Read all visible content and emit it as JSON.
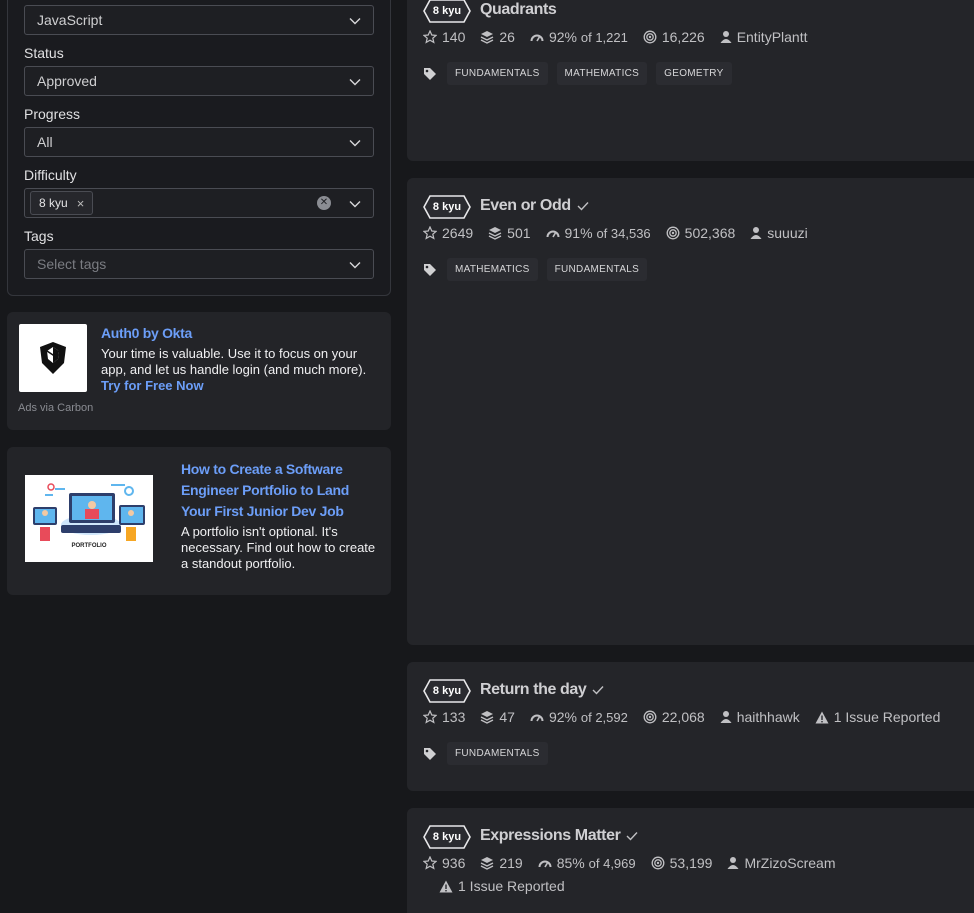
{
  "filters": {
    "language": {
      "value": "JavaScript"
    },
    "status": {
      "label": "Status",
      "value": "Approved"
    },
    "progress": {
      "label": "Progress",
      "value": "All"
    },
    "difficulty": {
      "label": "Difficulty",
      "chip": "8 kyu",
      "chip_remove": "×"
    },
    "tags": {
      "label": "Tags",
      "placeholder": "Select tags"
    }
  },
  "ad": {
    "title": "Auth0 by Okta",
    "text": "Your time is valuable. Use it to focus on your app, and let us handle login (and much more).",
    "cta": "Try for Free Now",
    "via": "Ads via Carbon"
  },
  "promo": {
    "title": "How to Create a Software Engineer Portfolio to Land Your First Junior Dev Job",
    "text": "A portfolio isn't optional. It's necessary. Find out how to create a standout portfolio.",
    "image_caption": "PORTFOLIO"
  },
  "katas": [
    {
      "kyu": "8 kyu",
      "title": "Quadrants",
      "completed": false,
      "stars": "140",
      "collections": "26",
      "satisfaction": "92%",
      "votes": "of 1,221",
      "completions": "16,226",
      "author": "EntityPlantt",
      "issues": "",
      "tags": [
        "FUNDAMENTALS",
        "MATHEMATICS",
        "GEOMETRY"
      ]
    },
    {
      "kyu": "8 kyu",
      "title": "Even or Odd",
      "completed": true,
      "stars": "2649",
      "collections": "501",
      "satisfaction": "91%",
      "votes": "of 34,536",
      "completions": "502,368",
      "author": "suuuzi",
      "issues": "",
      "tags": [
        "MATHEMATICS",
        "FUNDAMENTALS"
      ]
    },
    {
      "kyu": "8 kyu",
      "title": "Return the day",
      "completed": true,
      "stars": "133",
      "collections": "47",
      "satisfaction": "92%",
      "votes": "of 2,592",
      "completions": "22,068",
      "author": "haithhawk",
      "issues": "1 Issue Reported",
      "tags": [
        "FUNDAMENTALS"
      ]
    },
    {
      "kyu": "8 kyu",
      "title": "Expressions Matter",
      "completed": true,
      "stars": "936",
      "collections": "219",
      "satisfaction": "85%",
      "votes": "of 4,969",
      "completions": "53,199",
      "author": "MrZizoScream",
      "issues": "1 Issue Reported",
      "tags": []
    }
  ],
  "colors": {
    "background": "#17181b",
    "card": "#242529",
    "link": "#6c9ef8",
    "text": "#c0c0c3"
  }
}
